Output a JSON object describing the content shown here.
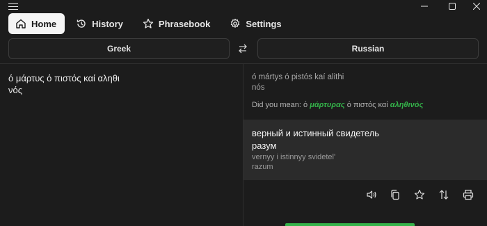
{
  "nav": {
    "tabs": [
      {
        "label": "Home",
        "icon": "home-icon",
        "active": true
      },
      {
        "label": "History",
        "icon": "history-icon",
        "active": false
      },
      {
        "label": "Phrasebook",
        "icon": "star-icon",
        "active": false
      },
      {
        "label": "Settings",
        "icon": "gear-icon",
        "active": false
      }
    ]
  },
  "languages": {
    "source": "Greek",
    "target": "Russian"
  },
  "source": {
    "text_line1": "ό μάρτυς ό πιστός καί αληθι",
    "text_line2": "νός"
  },
  "transliteration": {
    "line1": "ó mártys ó pistós kaí alithi",
    "line2": "nós"
  },
  "suggestion": {
    "prefix": "Did you mean:",
    "parts": [
      {
        "text": "ό",
        "highlight": false
      },
      {
        "text": "μάρτυρας",
        "highlight": true
      },
      {
        "text": "ό πιστός καί",
        "highlight": false
      },
      {
        "text": "αληθινός",
        "highlight": true
      }
    ]
  },
  "result": {
    "line1": "верный и истинный свидетель",
    "line2": "разум",
    "translit_line1": "vernyy i istinnyy svidetel'",
    "translit_line2": "razum"
  },
  "actions": [
    {
      "icon": "speaker-icon"
    },
    {
      "icon": "copy-icon"
    },
    {
      "icon": "star-icon"
    },
    {
      "icon": "swap-vertical-icon"
    },
    {
      "icon": "print-icon"
    }
  ],
  "colors": {
    "background": "#1c1c1c",
    "accent": "#34b34a",
    "result_background": "#2b2b2b"
  }
}
